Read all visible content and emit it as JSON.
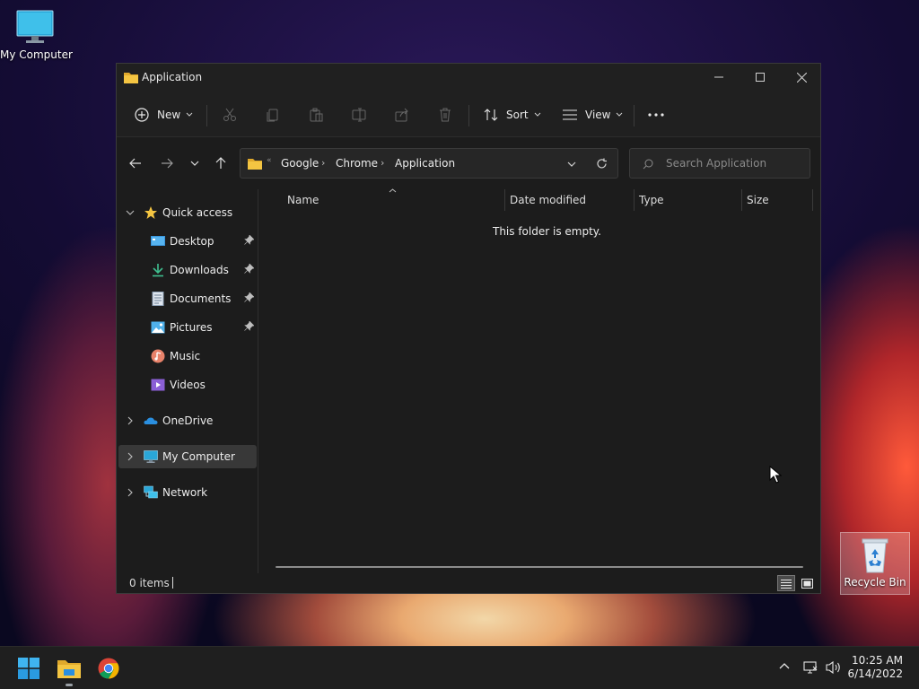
{
  "desktop": {
    "icons": [
      {
        "label": "My Computer",
        "icon": "monitor-icon"
      },
      {
        "label": "Recycle Bin",
        "icon": "recycle-bin-icon"
      }
    ]
  },
  "window": {
    "title": "Application",
    "controls": {
      "minimize": "minimize-icon",
      "maximize": "maximize-icon",
      "close": "close-icon"
    }
  },
  "toolbar": {
    "new_label": "New",
    "sort_label": "Sort",
    "view_label": "View",
    "actions": [
      "cut-icon",
      "copy-icon",
      "paste-icon",
      "rename-icon",
      "share-icon",
      "delete-icon"
    ],
    "more_icon": "more-icon"
  },
  "address": {
    "crumbs": [
      "Google",
      "Chrome",
      "Application"
    ],
    "overflow": "«"
  },
  "search": {
    "placeholder": "Search Application"
  },
  "sidebar": {
    "quick_access": "Quick access",
    "items": [
      {
        "label": "Desktop",
        "icon": "desktop-folder-icon",
        "pinned": true
      },
      {
        "label": "Downloads",
        "icon": "downloads-icon",
        "pinned": true
      },
      {
        "label": "Documents",
        "icon": "documents-icon",
        "pinned": true
      },
      {
        "label": "Pictures",
        "icon": "pictures-icon",
        "pinned": true
      },
      {
        "label": "Music",
        "icon": "music-icon",
        "pinned": false
      },
      {
        "label": "Videos",
        "icon": "videos-icon",
        "pinned": false
      }
    ],
    "onedrive": "OneDrive",
    "mycomputer": "My Computer",
    "network": "Network"
  },
  "columns": {
    "name": "Name",
    "date": "Date modified",
    "type": "Type",
    "size": "Size"
  },
  "content": {
    "empty_message": "This folder is empty."
  },
  "status": {
    "items": "0 items"
  },
  "taskbar": {
    "apps": [
      "start-icon",
      "file-explorer-icon",
      "chrome-icon"
    ],
    "time": "10:25 AM",
    "date": "6/14/2022"
  },
  "colors": {
    "window_bg": "#1c1c1c",
    "folder_yellow": "#f4c542",
    "accent_blue": "#3a96dd"
  }
}
